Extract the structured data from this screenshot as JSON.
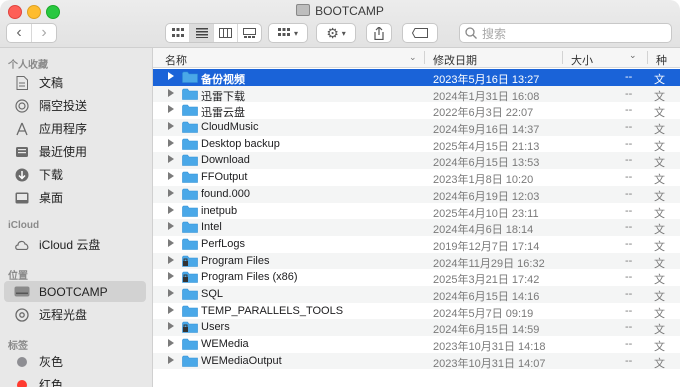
{
  "window": {
    "title": "BOOTCAMP"
  },
  "toolbar": {
    "back": "‹",
    "forward": "›",
    "search_placeholder": "搜索"
  },
  "sidebar": {
    "favorites_header": "个人收藏",
    "favorites": [
      {
        "label": "文稿",
        "icon": "document-icon"
      },
      {
        "label": "隔空投送",
        "icon": "airdrop-icon"
      },
      {
        "label": "应用程序",
        "icon": "applications-icon"
      },
      {
        "label": "最近使用",
        "icon": "recents-icon"
      },
      {
        "label": "下载",
        "icon": "downloads-icon"
      },
      {
        "label": "桌面",
        "icon": "desktop-icon"
      }
    ],
    "icloud_header": "iCloud",
    "icloud": [
      {
        "label": "iCloud 云盘",
        "icon": "cloud-icon"
      }
    ],
    "locations_header": "位置",
    "locations": [
      {
        "label": "BOOTCAMP",
        "icon": "drive-icon"
      },
      {
        "label": "远程光盘",
        "icon": "disc-icon"
      }
    ],
    "tags_header": "标签",
    "tags": [
      {
        "label": "灰色",
        "color": "#8e8e93"
      },
      {
        "label": "红色",
        "color": "#ff3b30"
      }
    ]
  },
  "columns": {
    "name": "名称",
    "date": "修改日期",
    "size": "大小",
    "kind": "种"
  },
  "files": [
    {
      "name": "备份视频",
      "date": "2023年5月16日 13:27",
      "size": "--",
      "kind": "文",
      "locked": false
    },
    {
      "name": "迅雷下载",
      "date": "2024年1月31日 16:08",
      "size": "--",
      "kind": "文",
      "locked": false
    },
    {
      "name": "迅雷云盘",
      "date": "2022年6月3日 22:07",
      "size": "--",
      "kind": "文",
      "locked": false
    },
    {
      "name": "CloudMusic",
      "date": "2024年9月16日 14:37",
      "size": "--",
      "kind": "文",
      "locked": false
    },
    {
      "name": "Desktop backup",
      "date": "2025年4月15日 21:13",
      "size": "--",
      "kind": "文",
      "locked": false
    },
    {
      "name": "Download",
      "date": "2024年6月15日 13:53",
      "size": "--",
      "kind": "文",
      "locked": false
    },
    {
      "name": "FFOutput",
      "date": "2023年1月8日 10:20",
      "size": "--",
      "kind": "文",
      "locked": false
    },
    {
      "name": "found.000",
      "date": "2024年6月19日 12:03",
      "size": "--",
      "kind": "文",
      "locked": false
    },
    {
      "name": "inetpub",
      "date": "2025年4月10日 23:11",
      "size": "--",
      "kind": "文",
      "locked": false
    },
    {
      "name": "Intel",
      "date": "2024年4月6日 18:14",
      "size": "--",
      "kind": "文",
      "locked": false
    },
    {
      "name": "PerfLogs",
      "date": "2019年12月7日 17:14",
      "size": "--",
      "kind": "文",
      "locked": false
    },
    {
      "name": "Program Files",
      "date": "2024年11月29日 16:32",
      "size": "--",
      "kind": "文",
      "locked": true
    },
    {
      "name": "Program Files (x86)",
      "date": "2025年3月21日 17:42",
      "size": "--",
      "kind": "文",
      "locked": true
    },
    {
      "name": "SQL",
      "date": "2024年6月15日 14:16",
      "size": "--",
      "kind": "文",
      "locked": false
    },
    {
      "name": "TEMP_PARALLELS_TOOLS",
      "date": "2024年5月7日 09:19",
      "size": "--",
      "kind": "文",
      "locked": false
    },
    {
      "name": "Users",
      "date": "2024年6月15日 14:59",
      "size": "--",
      "kind": "文",
      "locked": true
    },
    {
      "name": "WEMedia",
      "date": "2023年10月31日 14:18",
      "size": "--",
      "kind": "文",
      "locked": false
    },
    {
      "name": "WEMediaOutput",
      "date": "2023年10月31日 14:07",
      "size": "--",
      "kind": "文",
      "locked": false
    }
  ],
  "colors": {
    "selection": "#1a63d8",
    "folder": "#4aa8e8"
  }
}
